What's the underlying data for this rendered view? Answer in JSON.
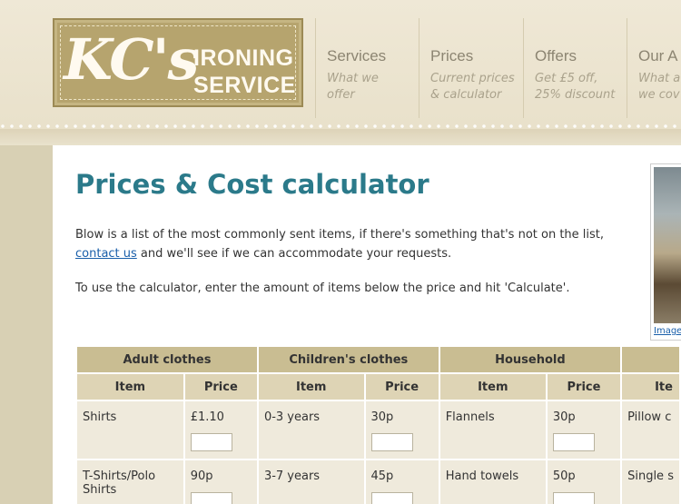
{
  "logo": {
    "main": "KC's",
    "line1": "IRONING",
    "line2": "SERVICE"
  },
  "nav": [
    {
      "title": "Services",
      "sub1": "What we",
      "sub2": "offer"
    },
    {
      "title": "Prices",
      "sub1": "Current prices",
      "sub2": "& calculator"
    },
    {
      "title": "Offers",
      "sub1": "Get £5 off,",
      "sub2": "25% discount"
    },
    {
      "title": "Our A",
      "sub1": "What a",
      "sub2": "we cov"
    }
  ],
  "page": {
    "title": "Prices & Cost calculator",
    "intro_before": "Blow is a list of the most commonly sent items, if there's something that's not on the list, ",
    "intro_link": "contact us",
    "intro_after": " and we'll see if we can accommodate your requests.",
    "instructions": "To use the calculator, enter the amount of items below the price and hit 'Calculate'.",
    "photo_caption": "Image"
  },
  "table": {
    "groups": [
      "Adult clothes",
      "Children's clothes",
      "Household",
      ""
    ],
    "item_header": "Item",
    "price_header": "Price",
    "last_item_header": "Ite",
    "rows": [
      {
        "adult_item": "Shirts",
        "adult_price": "£1.10",
        "child_item": "0-3 years",
        "child_price": "30p",
        "house_item": "Flannels",
        "house_price": "30p",
        "extra_item": "Pillow c"
      },
      {
        "adult_item": "T-Shirts/Polo Shirts",
        "adult_price": "90p",
        "child_item": "3-7 years",
        "child_price": "45p",
        "house_item": "Hand towels",
        "house_price": "50p",
        "extra_item": "Single s"
      }
    ]
  }
}
